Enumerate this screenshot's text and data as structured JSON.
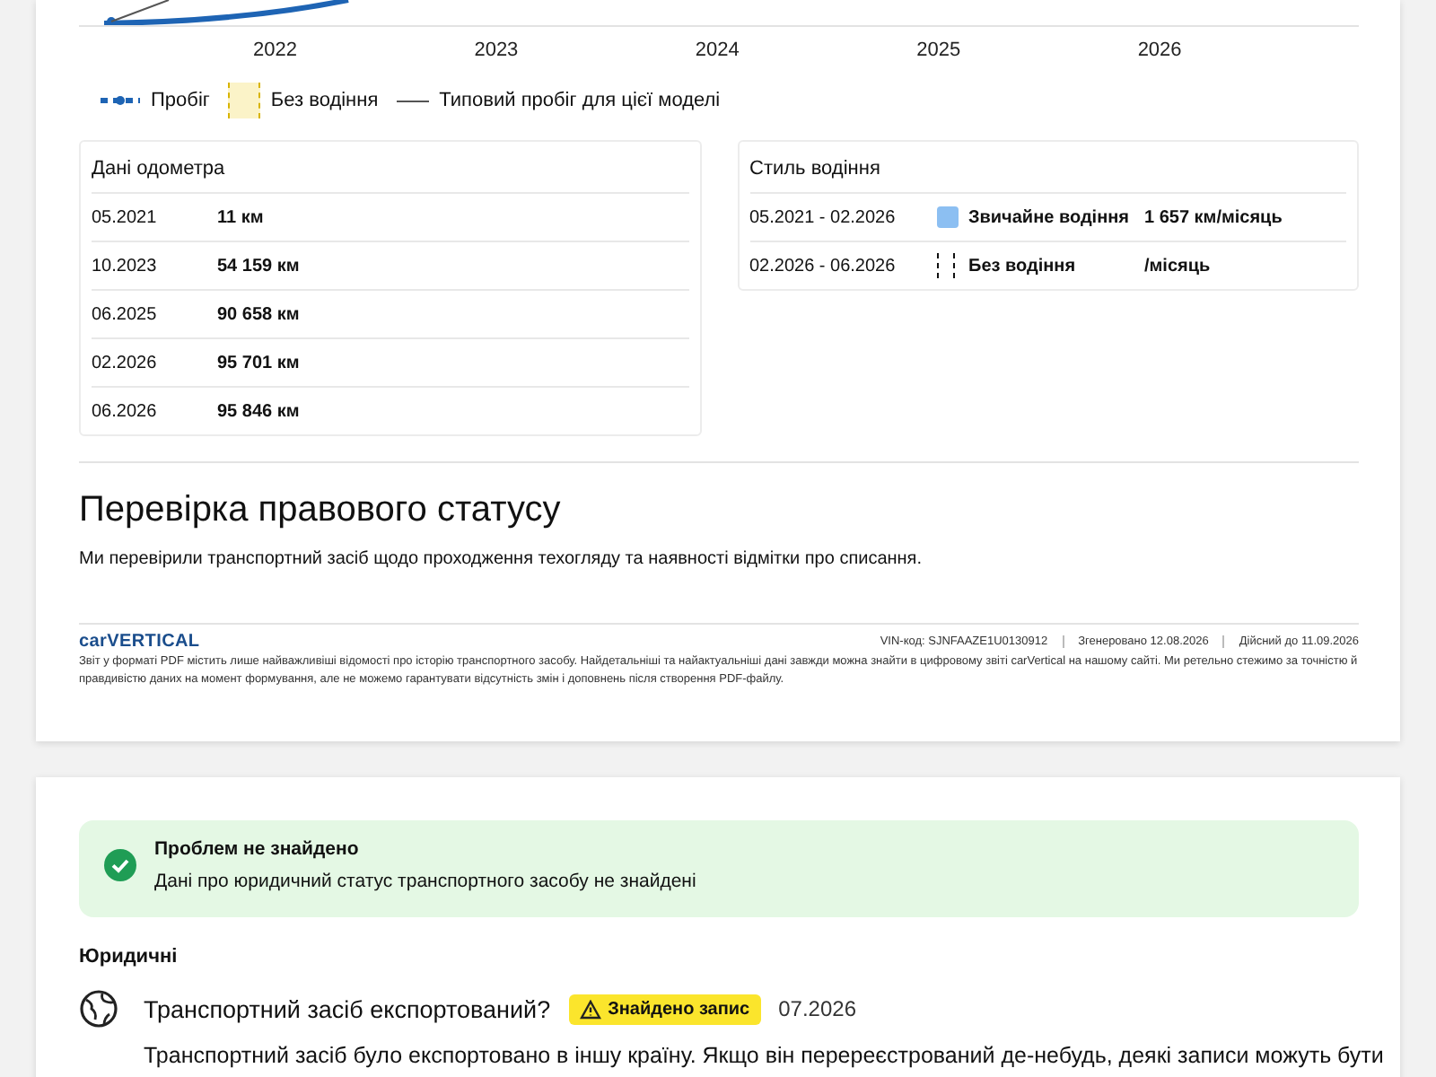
{
  "mileage_chart": {
    "year_labels": [
      "2022",
      "2023",
      "2024",
      "2025",
      "2026"
    ],
    "legend": [
      {
        "kind": "dotted-line",
        "label": "Пробіг"
      },
      {
        "kind": "hatched-box",
        "label": "Без водіння"
      },
      {
        "kind": "line",
        "label": "Типовий пробіг для цієї моделі"
      }
    ]
  },
  "odometer": {
    "title": "Дані одометра",
    "rows": [
      {
        "date": "05.2021",
        "value": "11 км"
      },
      {
        "date": "10.2023",
        "value": "54 159 км"
      },
      {
        "date": "06.2025",
        "value": "90 658 км"
      },
      {
        "date": "02.2026",
        "value": "95 701 км"
      },
      {
        "date": "06.2026",
        "value": "95 846 км"
      }
    ]
  },
  "driving_style": {
    "title": "Стиль водіння",
    "rows": [
      {
        "period": "05.2021 - 02.2026",
        "kind": "solid",
        "color": "#8cbff2",
        "style": "Звичайне водіння",
        "rate": "1 657 км/місяць"
      },
      {
        "period": "02.2026 - 06.2026",
        "kind": "dashed",
        "style": "Без водіння",
        "rate": "/місяць"
      }
    ]
  },
  "legal": {
    "heading": "Перевірка правового статусу",
    "text": "Ми перевірили транспортний засіб щодо проходження техогляду та наявності відмітки про списання."
  },
  "footer": {
    "brand": "carVERTICAL",
    "vin": "VIN-код: SJNFAAZE1U0130912",
    "generated": "Згенеровано 12.08.2026",
    "valid": "Дійсний до 11.09.2026",
    "note": "Звіт у форматі PDF містить лише найважливіші відомості про історію транспортного засобу. Найдетальніші та найактуальніші дані завжди можна знайти в цифровому звіті carVertical на нашому сайті. Ми ретельно стежимо за точністю й правдивістю даних на момент формування, але не можемо гарантувати відсутність змін і доповнень після створення PDF-файлу."
  },
  "status": {
    "title": "Проблем не знайдено",
    "text": "Дані про юридичний статус транспортного засобу не знайдені"
  },
  "section": "Юридичні",
  "checks": [
    {
      "title": "Транспортний засіб експортований?",
      "badge": "Знайдено запис",
      "date": "07.2026",
      "text": "Транспортний засіб було експортовано в іншу країну. Якщо він перереєстрований де-небудь, деякі записи можуть бути"
    }
  ]
}
